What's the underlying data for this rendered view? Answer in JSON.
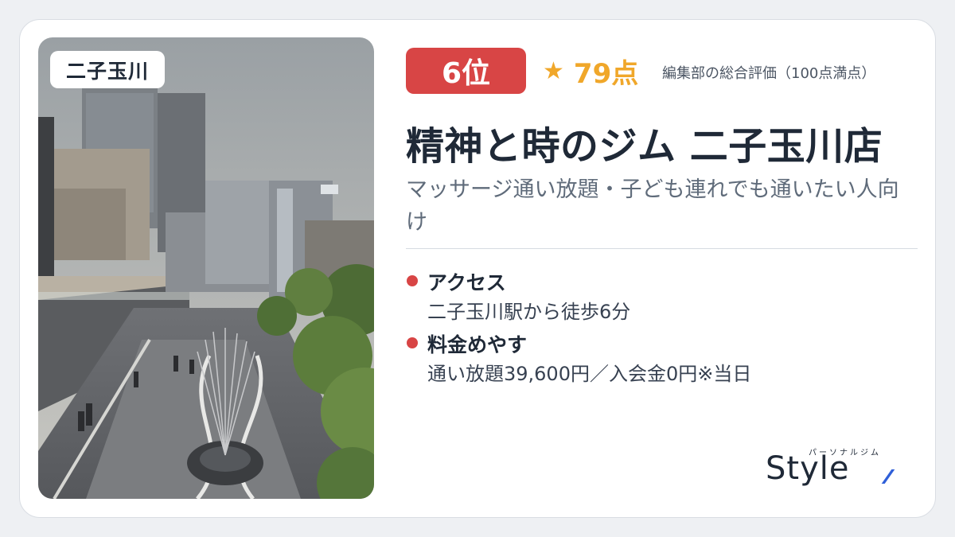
{
  "area": "二子玉川",
  "rank": "6位",
  "score": {
    "star": "★",
    "value": "79点",
    "note": "編集部の総合評価（100点満点）"
  },
  "shop_name": "精神と時のジム 二子玉川店",
  "catch_copy": "マッサージ通い放題・子ども連れでも通いたい人向け",
  "info": {
    "access": {
      "label": "アクセス",
      "detail": "二子玉川駅から徒歩6分"
    },
    "price": {
      "label": "料金めやす",
      "detail": "通い放題39,600円／入会金0円※当日"
    }
  },
  "logo": {
    "kana": "パーソナルジム",
    "wordmark": "Style"
  },
  "colors": {
    "accent_red": "#d84545",
    "star_gold": "#f0a72a",
    "logo_blue": "#2f5fd8"
  }
}
